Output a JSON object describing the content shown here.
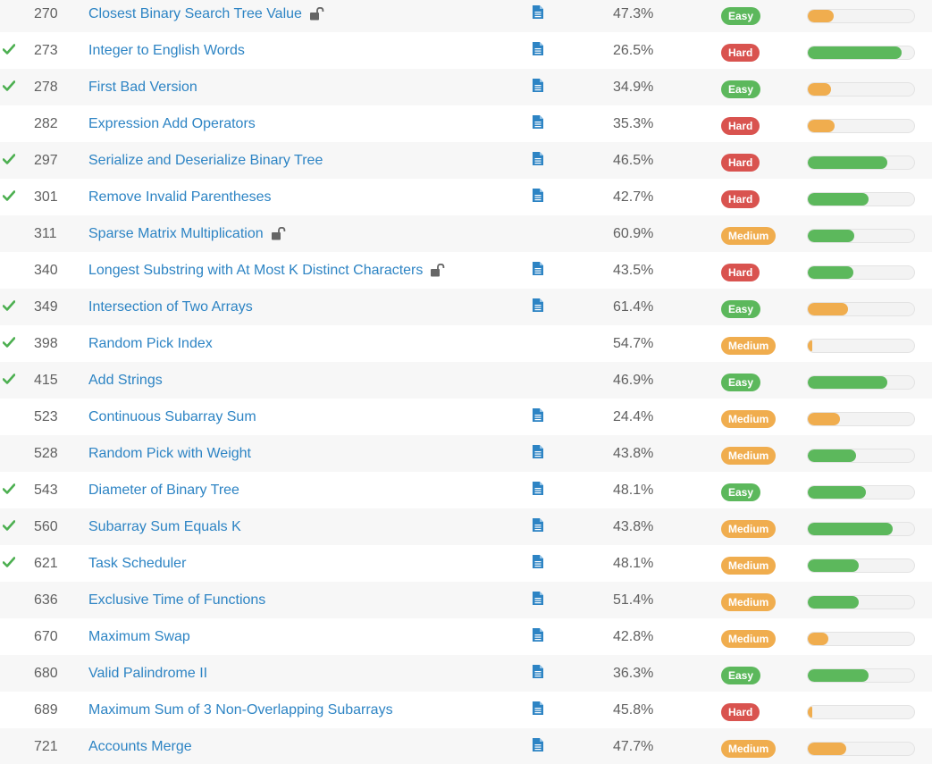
{
  "colors": {
    "link": "#2d84c4",
    "easy": "#5cb85c",
    "medium": "#f0ad4e",
    "hard": "#d9534f",
    "check": "#4caf50",
    "doc_icon": "#2d84c4",
    "lock_icon": "#666666"
  },
  "icons": {
    "solved": "check-icon",
    "solution": "document-icon",
    "premium": "unlocked-padlock-icon"
  },
  "problems": [
    {
      "id": "270",
      "title": "Closest Binary Search Tree Value",
      "solved": false,
      "locked": true,
      "has_solution": true,
      "acceptance": "47.3%",
      "difficulty": "Easy",
      "frequency": 0.24,
      "freq_color": "orange"
    },
    {
      "id": "273",
      "title": "Integer to English Words",
      "solved": true,
      "locked": false,
      "has_solution": true,
      "acceptance": "26.5%",
      "difficulty": "Hard",
      "frequency": 0.88,
      "freq_color": "green"
    },
    {
      "id": "278",
      "title": "First Bad Version",
      "solved": true,
      "locked": false,
      "has_solution": true,
      "acceptance": "34.9%",
      "difficulty": "Easy",
      "frequency": 0.22,
      "freq_color": "orange"
    },
    {
      "id": "282",
      "title": "Expression Add Operators",
      "solved": false,
      "locked": false,
      "has_solution": true,
      "acceptance": "35.3%",
      "difficulty": "Hard",
      "frequency": 0.25,
      "freq_color": "orange"
    },
    {
      "id": "297",
      "title": "Serialize and Deserialize Binary Tree",
      "solved": true,
      "locked": false,
      "has_solution": true,
      "acceptance": "46.5%",
      "difficulty": "Hard",
      "frequency": 0.75,
      "freq_color": "green"
    },
    {
      "id": "301",
      "title": "Remove Invalid Parentheses",
      "solved": true,
      "locked": false,
      "has_solution": true,
      "acceptance": "42.7%",
      "difficulty": "Hard",
      "frequency": 0.57,
      "freq_color": "green"
    },
    {
      "id": "311",
      "title": "Sparse Matrix Multiplication",
      "solved": false,
      "locked": true,
      "has_solution": false,
      "acceptance": "60.9%",
      "difficulty": "Medium",
      "frequency": 0.44,
      "freq_color": "green"
    },
    {
      "id": "340",
      "title": "Longest Substring with At Most K Distinct Characters",
      "solved": false,
      "locked": true,
      "has_solution": true,
      "acceptance": "43.5%",
      "difficulty": "Hard",
      "frequency": 0.43,
      "freq_color": "green"
    },
    {
      "id": "349",
      "title": "Intersection of Two Arrays",
      "solved": true,
      "locked": false,
      "has_solution": true,
      "acceptance": "61.4%",
      "difficulty": "Easy",
      "frequency": 0.38,
      "freq_color": "orange"
    },
    {
      "id": "398",
      "title": "Random Pick Index",
      "solved": true,
      "locked": false,
      "has_solution": false,
      "acceptance": "54.7%",
      "difficulty": "Medium",
      "frequency": 0.04,
      "freq_color": "orange"
    },
    {
      "id": "415",
      "title": "Add Strings",
      "solved": true,
      "locked": false,
      "has_solution": false,
      "acceptance": "46.9%",
      "difficulty": "Easy",
      "frequency": 0.75,
      "freq_color": "green"
    },
    {
      "id": "523",
      "title": "Continuous Subarray Sum",
      "solved": false,
      "locked": false,
      "has_solution": true,
      "acceptance": "24.4%",
      "difficulty": "Medium",
      "frequency": 0.3,
      "freq_color": "orange"
    },
    {
      "id": "528",
      "title": "Random Pick with Weight",
      "solved": false,
      "locked": false,
      "has_solution": true,
      "acceptance": "43.8%",
      "difficulty": "Medium",
      "frequency": 0.45,
      "freq_color": "green"
    },
    {
      "id": "543",
      "title": "Diameter of Binary Tree",
      "solved": true,
      "locked": false,
      "has_solution": true,
      "acceptance": "48.1%",
      "difficulty": "Easy",
      "frequency": 0.55,
      "freq_color": "green"
    },
    {
      "id": "560",
      "title": "Subarray Sum Equals K",
      "solved": true,
      "locked": false,
      "has_solution": true,
      "acceptance": "43.8%",
      "difficulty": "Medium",
      "frequency": 0.8,
      "freq_color": "green"
    },
    {
      "id": "621",
      "title": "Task Scheduler",
      "solved": true,
      "locked": false,
      "has_solution": true,
      "acceptance": "48.1%",
      "difficulty": "Medium",
      "frequency": 0.48,
      "freq_color": "green"
    },
    {
      "id": "636",
      "title": "Exclusive Time of Functions",
      "solved": false,
      "locked": false,
      "has_solution": true,
      "acceptance": "51.4%",
      "difficulty": "Medium",
      "frequency": 0.48,
      "freq_color": "green"
    },
    {
      "id": "670",
      "title": "Maximum Swap",
      "solved": false,
      "locked": false,
      "has_solution": true,
      "acceptance": "42.8%",
      "difficulty": "Medium",
      "frequency": 0.19,
      "freq_color": "orange"
    },
    {
      "id": "680",
      "title": "Valid Palindrome II",
      "solved": false,
      "locked": false,
      "has_solution": true,
      "acceptance": "36.3%",
      "difficulty": "Easy",
      "frequency": 0.57,
      "freq_color": "green"
    },
    {
      "id": "689",
      "title": "Maximum Sum of 3 Non-Overlapping Subarrays",
      "solved": false,
      "locked": false,
      "has_solution": true,
      "acceptance": "45.8%",
      "difficulty": "Hard",
      "frequency": 0.04,
      "freq_color": "orange"
    },
    {
      "id": "721",
      "title": "Accounts Merge",
      "solved": false,
      "locked": false,
      "has_solution": true,
      "acceptance": "47.7%",
      "difficulty": "Medium",
      "frequency": 0.36,
      "freq_color": "orange"
    }
  ]
}
